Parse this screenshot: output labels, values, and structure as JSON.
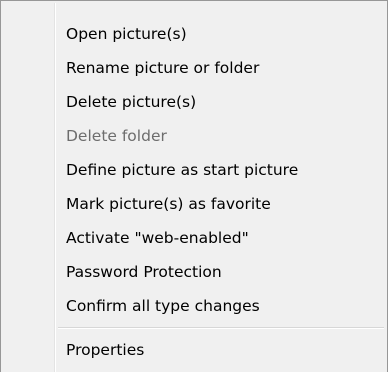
{
  "context_menu": {
    "items": [
      {
        "label": "Open picture(s)",
        "enabled": true
      },
      {
        "label": "Rename picture or folder",
        "enabled": true
      },
      {
        "label": "Delete picture(s)",
        "enabled": true
      },
      {
        "label": "Delete folder",
        "enabled": false
      },
      {
        "label": "Define picture as start picture",
        "enabled": true
      },
      {
        "label": "Mark picture(s) as favorite",
        "enabled": true
      },
      {
        "label": "Activate \"web-enabled\"",
        "enabled": true
      },
      {
        "label": "Password Protection",
        "enabled": true
      },
      {
        "label": "Confirm all type changes",
        "enabled": true
      }
    ],
    "footer_items": [
      {
        "label": "Properties",
        "enabled": true
      }
    ],
    "colors": {
      "background": "#f0f0f0",
      "border": "#979797",
      "text": "#000000",
      "disabled_text": "#6d6d6d",
      "separator": "#d7d7d7"
    }
  }
}
